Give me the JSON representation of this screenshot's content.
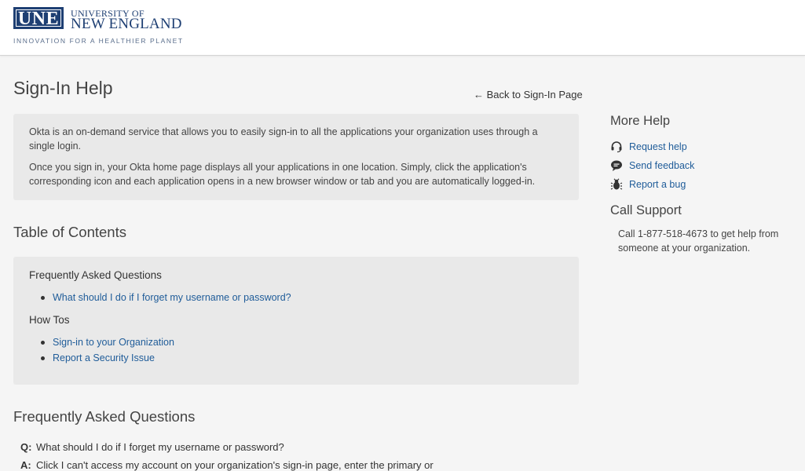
{
  "header": {
    "logo_abbr": "UNE",
    "logo_line1": "UNIVERSITY OF",
    "logo_line2": "NEW ENGLAND",
    "tagline": "INNOVATION FOR A HEALTHIER PLANET"
  },
  "page": {
    "title": "Sign-In Help",
    "back_link": "← Back to Sign-In Page"
  },
  "intro": {
    "paragraph1": "Okta is an on-demand service that allows you to easily sign-in to all the applications your organization uses through a single login.",
    "paragraph2": "Once you sign in, your Okta home page displays all your applications in one location. Simply, click the application's corresponding icon and each application opens in a new browser window or tab and you are automatically logged-in."
  },
  "toc": {
    "heading": "Table of Contents",
    "groups": [
      {
        "title": "Frequently Asked Questions",
        "items": [
          "What should I do if I forget my username or password?"
        ]
      },
      {
        "title": "How Tos",
        "items": [
          "Sign-in to your Organization",
          "Report a Security Issue"
        ]
      }
    ]
  },
  "faq": {
    "heading": "Frequently Asked Questions",
    "q_label": "Q:",
    "a_label": "A:",
    "question": "What should I do if I forget my username or password?",
    "answer": "Click I can't access my account on your organization's sign-in page, enter the primary or"
  },
  "sidebar": {
    "more_help_title": "More Help",
    "help_items": [
      {
        "label": "Request help",
        "icon": "headset-icon"
      },
      {
        "label": "Send feedback",
        "icon": "speech-bubble-icon"
      },
      {
        "label": "Report a bug",
        "icon": "bug-icon"
      }
    ],
    "call_support_title": "Call Support",
    "call_support_text": "Call 1-877-518-4673 to get help from someone at your organization."
  },
  "colors": {
    "brand_navy": "#1e3f73",
    "link_blue": "#1f5c99",
    "panel_gray": "#e9e9e9",
    "page_bg": "#f5f5f5"
  }
}
